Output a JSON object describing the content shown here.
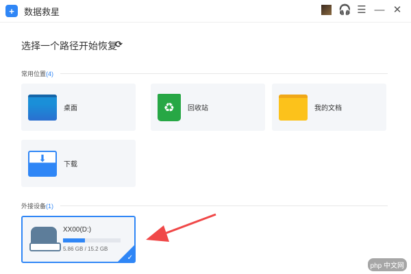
{
  "app": {
    "title": "数据救星"
  },
  "heading": "选择一个路径开始恢复",
  "sections": [
    {
      "label": "常用位置",
      "count": "(4)"
    },
    {
      "label": "外接设备",
      "count": "(1)"
    }
  ],
  "locations": [
    {
      "label": "桌面"
    },
    {
      "label": "回收站"
    },
    {
      "label": "我的文档"
    },
    {
      "label": "下载"
    }
  ],
  "device": {
    "name": "XX00(D:)",
    "used": "5.86 GB",
    "total": "15.2 GB",
    "size_text": "5.86 GB / 15.2 GB",
    "used_fraction": 0.385
  },
  "watermark": "php 中文网"
}
